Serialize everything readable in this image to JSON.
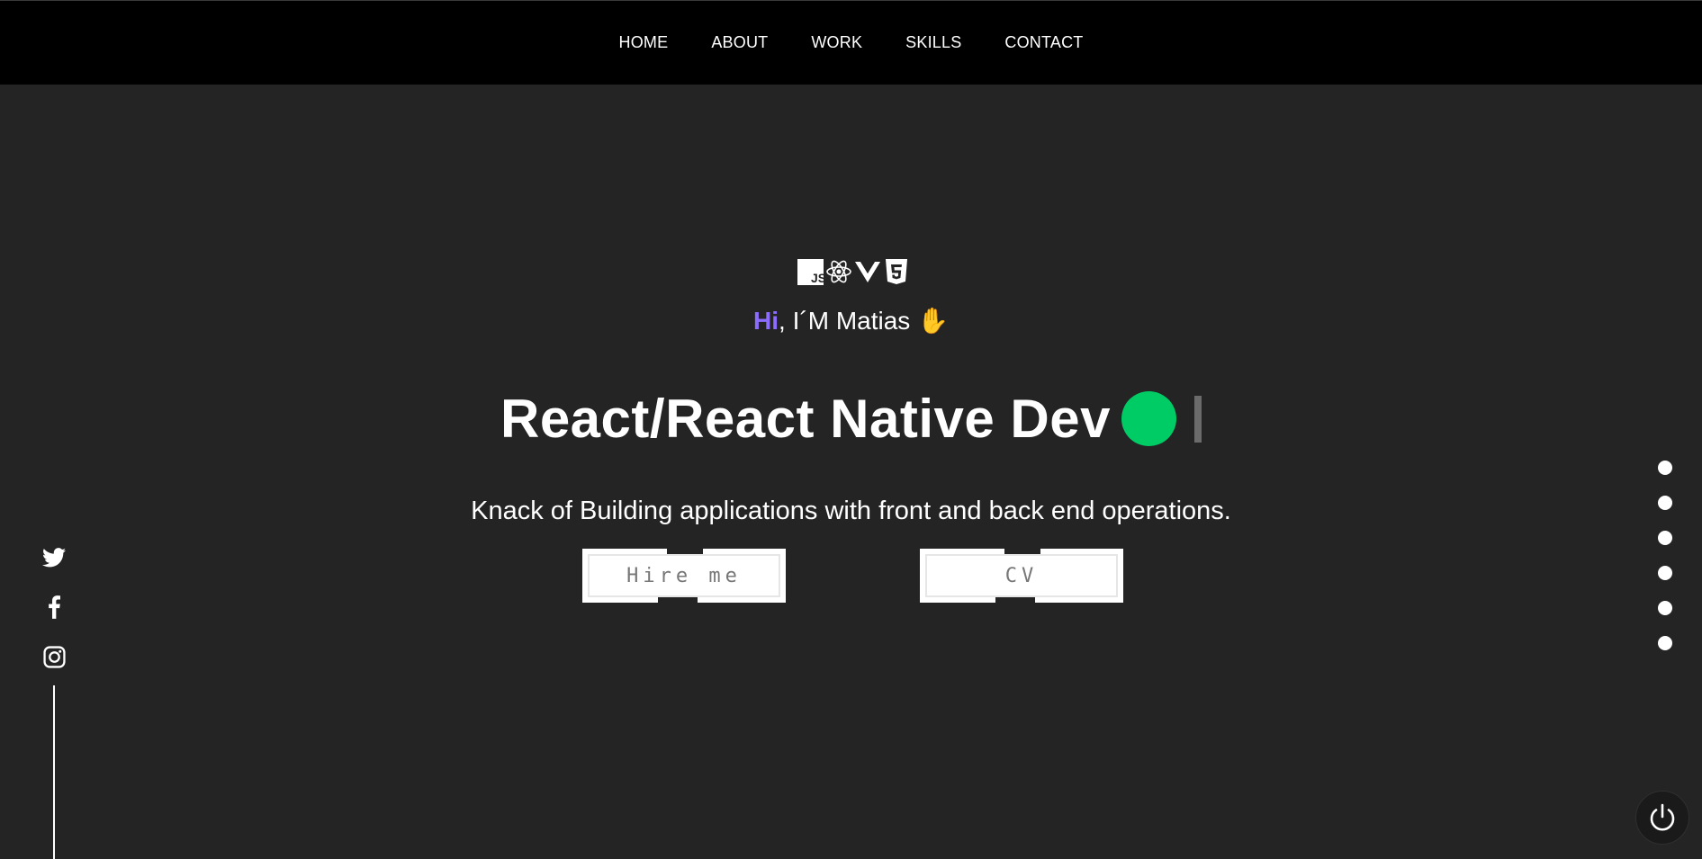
{
  "nav": {
    "items": [
      {
        "label": "HOME"
      },
      {
        "label": "ABOUT"
      },
      {
        "label": "WORK"
      },
      {
        "label": "SKILLS"
      },
      {
        "label": "CONTACT"
      }
    ]
  },
  "hero": {
    "tech_icons": [
      "javascript-icon",
      "react-icon",
      "vue-icon",
      "html5-icon"
    ],
    "greeting_hi": "Hi",
    "greeting_rest": ", I´M Matias",
    "greeting_emoji": "✋",
    "headline": "React/React Native Dev",
    "tagline": "Knack of Building applications with front and back end operations.",
    "buttons": {
      "hire": "Hire me",
      "cv": "CV"
    }
  },
  "socials": [
    "twitter-icon",
    "facebook-icon",
    "instagram-icon"
  ],
  "section_dots": {
    "count": 6
  },
  "colors": {
    "background": "#242424",
    "nav_background": "#000000",
    "accent_hi": "#8b6cff",
    "status_dot": "#00cc66"
  },
  "power_button": {
    "icon": "power-icon"
  }
}
